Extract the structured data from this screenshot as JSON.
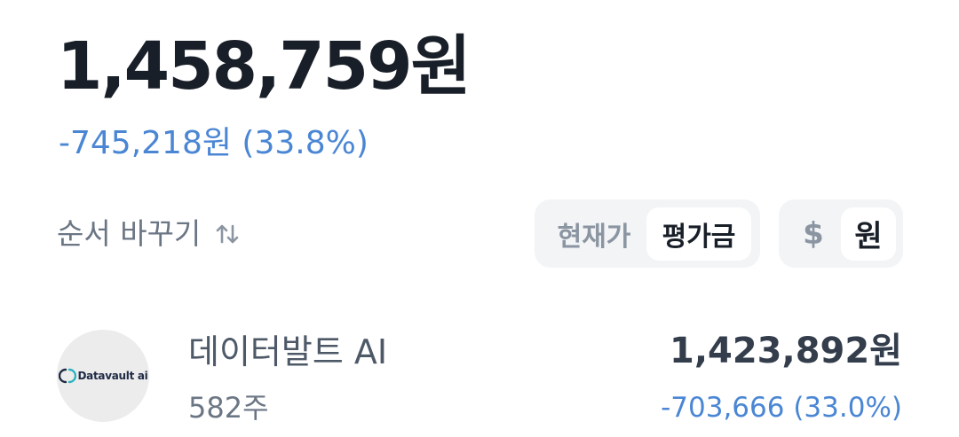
{
  "summary": {
    "total_value": "1,458,759원",
    "change": "-745,218원 (33.8%)"
  },
  "controls": {
    "sort_label": "순서 바꾸기",
    "sort_icon": "sort-arrows-icon",
    "price_toggle": {
      "options": [
        "현재가",
        "평가금"
      ],
      "selected": "평가금"
    },
    "currency_toggle": {
      "options": [
        "$",
        "원"
      ],
      "selected": "원"
    }
  },
  "holdings": [
    {
      "logo_text": "Datavault ai",
      "name": "데이터발트 AI",
      "quantity": "582주",
      "value": "1,423,892원",
      "change": "-703,666 (33.0%)"
    }
  ],
  "colors": {
    "primary_text": "#191f28",
    "secondary_text": "#6b7684",
    "loss_blue": "#4a86d4",
    "segment_bg": "#f2f4f6"
  }
}
